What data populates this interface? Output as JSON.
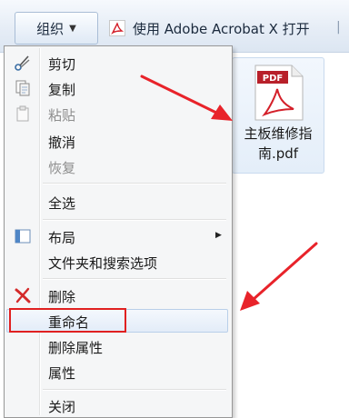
{
  "toolbar": {
    "organize_label": "组织",
    "open_with_label": "使用 Adobe Acrobat X 打开"
  },
  "file": {
    "icon_badge": "PDF",
    "name_line1": "主板维修指",
    "name_line2": "南.pdf"
  },
  "menu": {
    "items": [
      {
        "label": "剪切",
        "icon": "scissors-icon",
        "enabled": true
      },
      {
        "label": "复制",
        "icon": "copy-icon",
        "enabled": true
      },
      {
        "label": "粘贴",
        "icon": "paste-icon",
        "enabled": false
      },
      {
        "label": "撤消",
        "enabled": true
      },
      {
        "label": "恢复",
        "enabled": false
      },
      {
        "label": "全选",
        "enabled": true
      },
      {
        "label": "布局",
        "icon": "layout-icon",
        "enabled": true,
        "submenu": true
      },
      {
        "label": "文件夹和搜索选项",
        "enabled": true
      },
      {
        "label": "删除",
        "icon": "delete-x-icon",
        "enabled": true
      },
      {
        "label": "重命名",
        "enabled": true,
        "highlighted": true
      },
      {
        "label": "删除属性",
        "enabled": true
      },
      {
        "label": "属性",
        "enabled": true
      },
      {
        "label": "关闭",
        "enabled": true
      }
    ]
  },
  "annotations": {
    "arrow_color": "#e8232a",
    "highlight_box_color": "#e02020"
  }
}
